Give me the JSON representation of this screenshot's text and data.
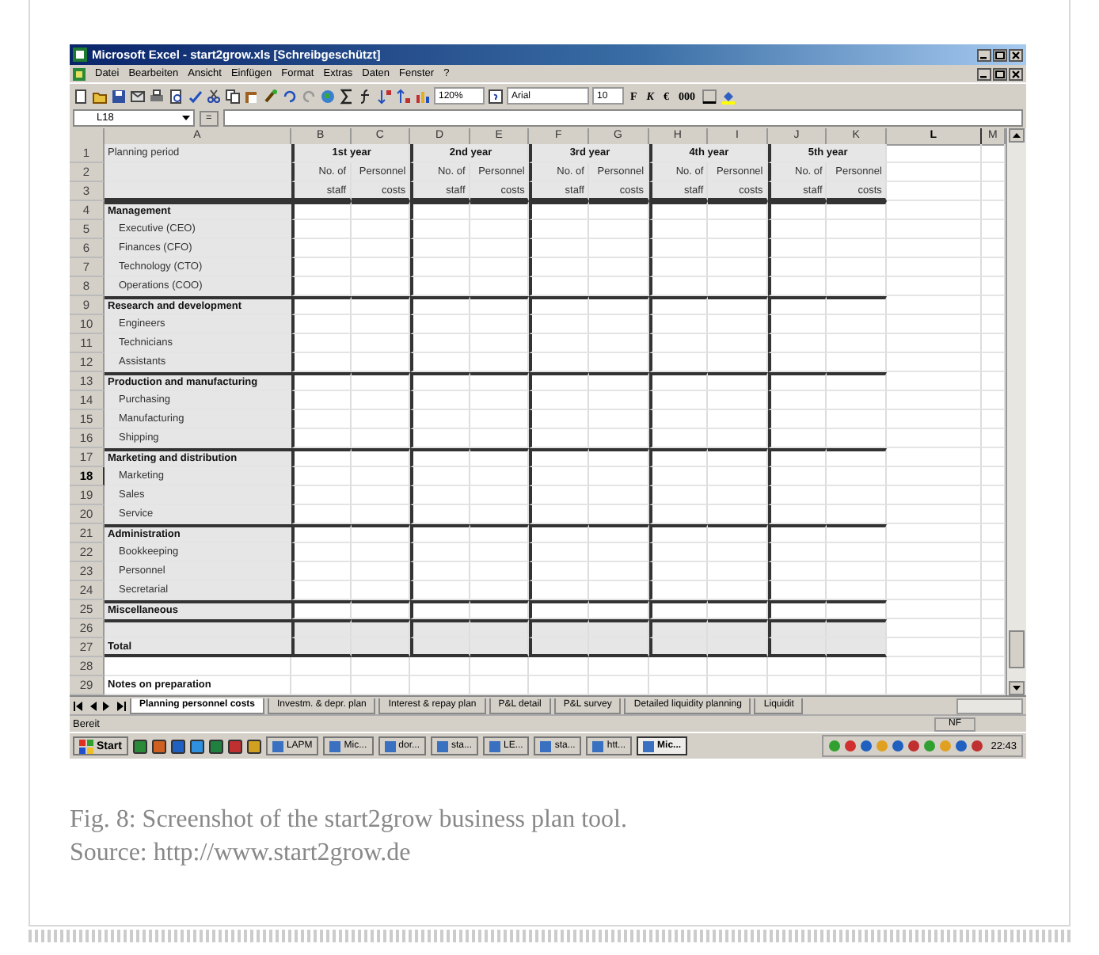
{
  "window": {
    "title": "Microsoft Excel - start2grow.xls [Schreibgeschützt]"
  },
  "menu": [
    "Datei",
    "Bearbeiten",
    "Ansicht",
    "Einfügen",
    "Format",
    "Extras",
    "Daten",
    "Fenster",
    "?"
  ],
  "toolbar": {
    "zoom": "120%",
    "font": "Arial",
    "size": "10",
    "format_buttons": [
      "F",
      "K",
      "€",
      "000"
    ]
  },
  "formula_bar": {
    "name_box": "L18",
    "equals": "="
  },
  "columns": [
    {
      "label": "A",
      "selected": false
    },
    {
      "label": "B",
      "selected": false
    },
    {
      "label": "C",
      "selected": false
    },
    {
      "label": "D",
      "selected": false
    },
    {
      "label": "E",
      "selected": false
    },
    {
      "label": "F",
      "selected": false
    },
    {
      "label": "G",
      "selected": false
    },
    {
      "label": "H",
      "selected": false
    },
    {
      "label": "I",
      "selected": false
    },
    {
      "label": "J",
      "selected": false
    },
    {
      "label": "K",
      "selected": false
    },
    {
      "label": "L",
      "selected": true
    },
    {
      "label": "M",
      "selected": false
    }
  ],
  "years": [
    {
      "title": "1st year",
      "subheads": [
        [
          "No. of",
          "Personnel"
        ],
        [
          "staff",
          "costs"
        ]
      ]
    },
    {
      "title": "2nd year",
      "subheads": [
        [
          "No. of",
          "Personnel"
        ],
        [
          "staff",
          "costs"
        ]
      ]
    },
    {
      "title": "3rd year",
      "subheads": [
        [
          "No. of",
          "Personnel"
        ],
        [
          "staff",
          "costs"
        ]
      ]
    },
    {
      "title": "4th year",
      "subheads": [
        [
          "No. of",
          "Personnel"
        ],
        [
          "staff",
          "costs"
        ]
      ]
    },
    {
      "title": "5th year",
      "subheads": [
        [
          "No. of",
          "Personnel"
        ],
        [
          "staff",
          "costs"
        ]
      ]
    }
  ],
  "rows": [
    {
      "number": "1",
      "label": "Planning period",
      "kind": "header",
      "selected": false
    },
    {
      "number": "2",
      "kind": "header",
      "selected": false
    },
    {
      "number": "3",
      "kind": "header",
      "selected": false
    },
    {
      "number": "4",
      "label": "Management",
      "kind": "section",
      "selected": false
    },
    {
      "number": "5",
      "label": "Executive (CEO)",
      "kind": "item",
      "selected": false
    },
    {
      "number": "6",
      "label": "Finances (CFO)",
      "kind": "item",
      "selected": false
    },
    {
      "number": "7",
      "label": "Technology (CTO)",
      "kind": "item",
      "selected": false
    },
    {
      "number": "8",
      "label": "Operations (COO)",
      "kind": "item",
      "selected": false
    },
    {
      "number": "9",
      "label": "Research and development",
      "kind": "section",
      "selected": false
    },
    {
      "number": "10",
      "label": "Engineers",
      "kind": "item",
      "selected": false
    },
    {
      "number": "11",
      "label": "Technicians",
      "kind": "item",
      "selected": false
    },
    {
      "number": "12",
      "label": "Assistants",
      "kind": "item",
      "selected": false
    },
    {
      "number": "13",
      "label": "Production and manufacturing",
      "kind": "section",
      "selected": false
    },
    {
      "number": "14",
      "label": "Purchasing",
      "kind": "item",
      "selected": false
    },
    {
      "number": "15",
      "label": "Manufacturing",
      "kind": "item",
      "selected": false
    },
    {
      "number": "16",
      "label": "Shipping",
      "kind": "item",
      "selected": false
    },
    {
      "number": "17",
      "label": "Marketing and distribution",
      "kind": "section",
      "selected": false
    },
    {
      "number": "18",
      "label": "Marketing",
      "kind": "item",
      "selected": true
    },
    {
      "number": "19",
      "label": "Sales",
      "kind": "item",
      "selected": false
    },
    {
      "number": "20",
      "label": "Service",
      "kind": "item",
      "selected": false
    },
    {
      "number": "21",
      "label": "Administration",
      "kind": "section",
      "selected": false
    },
    {
      "number": "22",
      "label": "Bookkeeping",
      "kind": "item",
      "selected": false
    },
    {
      "number": "23",
      "label": "Personnel",
      "kind": "item",
      "selected": false
    },
    {
      "number": "24",
      "label": "Secretarial",
      "kind": "item",
      "selected": false
    },
    {
      "number": "25",
      "label": "Miscellaneous",
      "kind": "section",
      "selected": false
    },
    {
      "number": "26",
      "kind": "total",
      "selected": false
    },
    {
      "number": "27",
      "label": "Total",
      "kind": "total",
      "selected": false
    },
    {
      "number": "28",
      "kind": "blank",
      "selected": false
    },
    {
      "number": "29",
      "label": "Notes on preparation",
      "kind": "notes",
      "selected": false
    }
  ],
  "sheet_tabs": [
    {
      "label": "Planning personnel costs",
      "selected": true
    },
    {
      "label": "Investm. & depr. plan",
      "selected": false
    },
    {
      "label": "Interest & repay plan",
      "selected": false
    },
    {
      "label": "P&L detail",
      "selected": false
    },
    {
      "label": "P&L survey",
      "selected": false
    },
    {
      "label": "Detailed liquidity planning",
      "selected": false
    },
    {
      "label": "Liquidit",
      "selected": false
    }
  ],
  "status_bar": {
    "left": "Bereit",
    "right": "NF"
  },
  "taskbar": {
    "start": "Start",
    "tasks": [
      {
        "label": "LAPM",
        "selected": false
      },
      {
        "label": "Mic...",
        "selected": false
      },
      {
        "label": "dor...",
        "selected": false
      },
      {
        "label": "sta...",
        "selected": false
      },
      {
        "label": "LE...",
        "selected": false
      },
      {
        "label": "sta...",
        "selected": false
      },
      {
        "label": "htt...",
        "selected": false
      },
      {
        "label": "Mic...",
        "selected": true
      }
    ],
    "clock": "22:43"
  },
  "caption": [
    "Fig. 8: Screenshot of the start2grow business plan tool.",
    "Source: http://www.start2grow.de"
  ]
}
